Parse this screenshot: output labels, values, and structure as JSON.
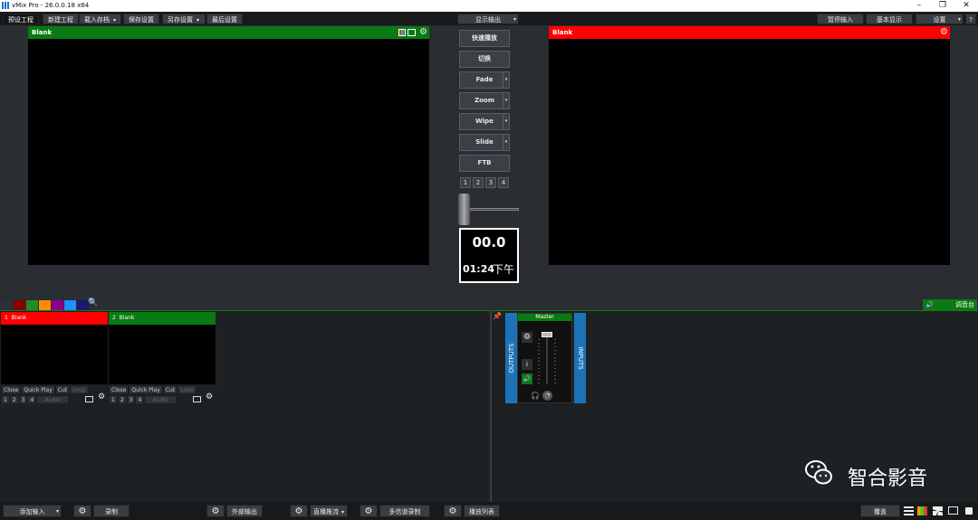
{
  "window": {
    "title": "vMix Pro - 26.0.0.18 x64",
    "min": "–",
    "restore": "❐",
    "close": "✕"
  },
  "menu": {
    "preset": "预设工程",
    "new_project": "新建工程",
    "open_archive": "载入存档",
    "save_settings": "保存设置",
    "save_as": "另存设置",
    "recent": "最后设置",
    "display_output": "显示输出",
    "pause_input": "暂停输入",
    "basic_display": "基本显示",
    "settings": "设置",
    "help": "?"
  },
  "preview": {
    "label": "Blank",
    "header_color": "#0a7a12"
  },
  "output": {
    "label": "Blank",
    "header_color": "#ff0000"
  },
  "transitions": {
    "quick_play": "快速播放",
    "cut": "切换",
    "fade": "Fade",
    "zoom": "Zoom",
    "wipe": "Wipe",
    "slide": "Slide",
    "ftb": "FTB",
    "numbers": [
      "1",
      "2",
      "3",
      "4"
    ],
    "drop": "▾"
  },
  "clock": {
    "timer": "00.0",
    "time": "01:24",
    "ampm": "下午"
  },
  "color_tabs": [
    "#2d3035",
    "#8b0000",
    "#228b22",
    "#ff8c00",
    "#8b008b",
    "#1e90ff",
    "#191970"
  ],
  "search_icon": "🔍",
  "audio_toggle": {
    "icon": "🔊",
    "label": "调音台"
  },
  "inputs": [
    {
      "number": "1",
      "name": "Blank",
      "color": "#ff0000",
      "controls": [
        "Close",
        "Quick Play",
        "Cut",
        "Loop"
      ],
      "nums": [
        "1",
        "2",
        "3",
        "4"
      ],
      "audio": "Audio"
    },
    {
      "number": "2",
      "name": "Blank",
      "color": "#0a7a12",
      "controls": [
        "Close",
        "Quick Play",
        "Cut",
        "Loop"
      ],
      "nums": [
        "1",
        "2",
        "3",
        "4"
      ],
      "audio": "Audio"
    }
  ],
  "mixer": {
    "outputs": "OUTPUTS",
    "inputs": "INPUTS",
    "master": "Master",
    "pin": "📌",
    "info": "i",
    "speaker": "🔊",
    "headphones": "🎧",
    "knob": "◔"
  },
  "watermark": "智合影音",
  "bottom": {
    "add_input": "添加输入",
    "record": "录制",
    "external": "外部输出",
    "stream": "直播推流",
    "multicorder": "多信道录制",
    "playlist": "播放列表",
    "overlay": "覆盖",
    "gear": "⚙",
    "caret": "▾"
  }
}
